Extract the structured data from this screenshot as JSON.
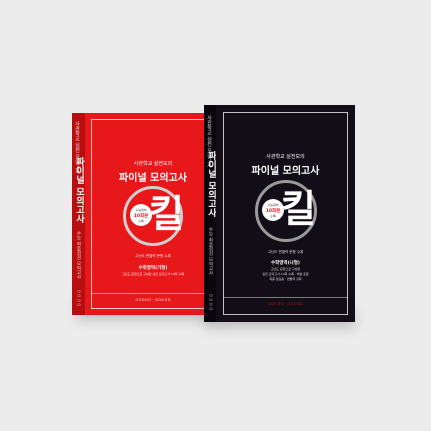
{
  "red_book": {
    "spine": {
      "top_text": "사관학교 실전 모의고사",
      "title": "파이널 모의고사",
      "subtitle": "수능 최종점검 모의고사",
      "bottom_text": "ㅁㅁㅁㅁ"
    },
    "cover": {
      "series": "사관학교 실전모의",
      "title": "파이널 모의고사",
      "badge_top": "수능대비",
      "badge_mid": "10회분",
      "badge_bottom": "수록",
      "glyph": "킬",
      "tagline": "고난도 변별력 문항 수록",
      "subject": "수학영역(가형)",
      "desc": "고난도 문항으로 구성된 실전 모의고사 10회 수록",
      "publisher": "ㅁㅁㅁㅁㅁ · ㅁㅁㅁㅁㅁ"
    }
  },
  "black_book": {
    "spine": {
      "top_text": "사관학교 실전 모의고사",
      "title": "파이널 모의고사",
      "subtitle": "수능 최종점검 모의고사",
      "bottom_text": "ㅁㅁㅁㅁ"
    },
    "cover": {
      "series": "사관학교 실전모의",
      "title": "파이널 모의고사",
      "badge_top": "수능대비",
      "badge_mid": "10회분",
      "badge_bottom": "수록",
      "glyph": "킬",
      "tagline": "고난도 변별력 문항 수록",
      "subject": "수학영역(나형)",
      "desc1": "고난도 문항으로 구성된",
      "desc2": "실전 모의고사 10회 수록 · 해설 포함",
      "desc3": "최종 점검용 · 변별력 강화",
      "publisher": "ㅁㅁㅁㅁㅁ · ㅁㅁㅁㅁㅁ"
    }
  },
  "colors": {
    "background": "#ececec",
    "red_cover": "#e8171a",
    "red_spine": "#b80e10",
    "black_cover": "#120d16",
    "black_spine": "#0a070c",
    "accent_red": "#e51b1e",
    "ring_gray": "#9a9a9a"
  }
}
